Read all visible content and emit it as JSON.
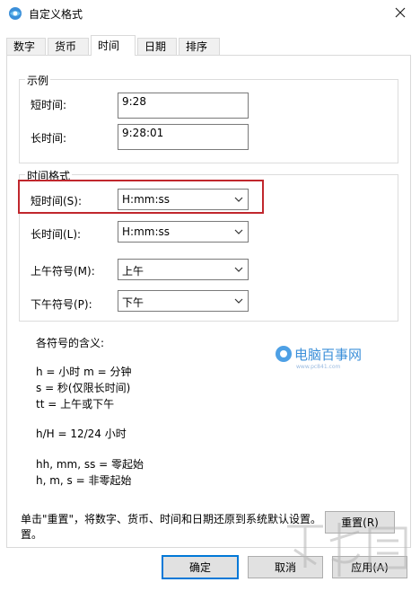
{
  "window": {
    "title": "自定义格式"
  },
  "tabs": [
    {
      "label": "数字"
    },
    {
      "label": "货币"
    },
    {
      "label": "时间"
    },
    {
      "label": "日期"
    },
    {
      "label": "排序"
    }
  ],
  "example_group": {
    "legend": "示例",
    "short_time_label": "短时间:",
    "short_time_value": "9:28",
    "long_time_label": "长时间:",
    "long_time_value": "9:28:01"
  },
  "format_group": {
    "legend": "时间格式",
    "short_time_label": "短时间(S):",
    "short_time_value": "H:mm:ss",
    "long_time_label": "长时间(L):",
    "long_time_value": "H:mm:ss",
    "am_label": "上午符号(M):",
    "am_value": "上午",
    "pm_label": "下午符号(P):",
    "pm_value": "下午"
  },
  "legend_text": {
    "heading": "各符号的含义:",
    "line1": "h = 小时   m = 分钟",
    "line2": "s = 秒(仅限长时间)",
    "line3": "tt = 上午或下午",
    "line4": "h/H = 12/24 小时",
    "line5": "hh, mm, ss = 零起始",
    "line6": "h, m, s = 非零起始"
  },
  "reset_note": {
    "line1": "单击\"重置\"，将数字、货币、时间和日期还原到系统默认设置。",
    "line2": "置。"
  },
  "buttons": {
    "reset": "重置(R)",
    "ok": "确定",
    "cancel": "取消",
    "apply": "应用(A)"
  },
  "watermark": {
    "text": "电脑百事网",
    "sub": "www.pc841.com"
  },
  "colors": {
    "highlight": "#c0272d",
    "accent": "#0078d7"
  }
}
